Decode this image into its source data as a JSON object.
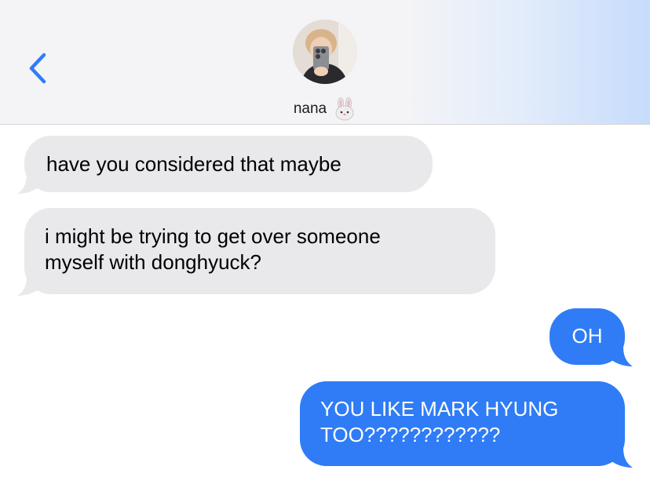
{
  "header": {
    "contact_name": "nana",
    "name_emoji": "rabbit-face-icon",
    "back_icon": "chevron-left-icon",
    "accent_color": "#2f7cf6"
  },
  "messages": [
    {
      "direction": "incoming",
      "text": "have you considered that maybe"
    },
    {
      "direction": "incoming",
      "lines": [
        "i might be trying to get over someone",
        "myself with donghyuck?"
      ]
    },
    {
      "direction": "outgoing",
      "text": "OH"
    },
    {
      "direction": "outgoing",
      "lines": [
        "YOU LIKE MARK HYUNG",
        "TOO????????????"
      ]
    }
  ],
  "colors": {
    "incoming_bubble": "#e9e9eb",
    "outgoing_bubble": "#2f7cf6",
    "header_bg": "#f4f4f6"
  }
}
